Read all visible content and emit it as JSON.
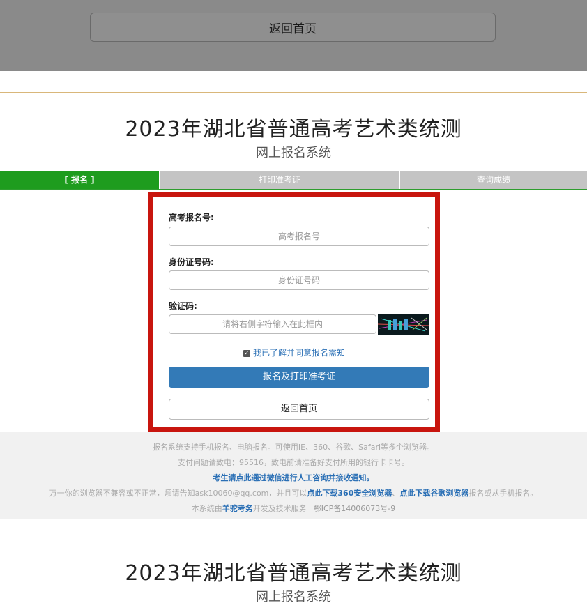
{
  "top_bar": {
    "back_label": "返回首页"
  },
  "header": {
    "title": "2023年湖北省普通高考艺术类统测",
    "subtitle": "网上报名系统"
  },
  "tabs": [
    {
      "label": "[ 报名 ]",
      "active": true
    },
    {
      "label": "打印准考证",
      "active": false
    },
    {
      "label": "查询成绩",
      "active": false
    }
  ],
  "form": {
    "exam_no_label": "高考报名号:",
    "exam_no_placeholder": "高考报名号",
    "id_label": "身份证号码:",
    "id_placeholder": "身份证号码",
    "captcha_label": "验证码:",
    "captcha_placeholder": "请将右侧字符输入在此框内",
    "agree_text": "我已了解并同意报名需知",
    "agree_checked": true,
    "submit_label": "报名及打印准考证",
    "back_label": "返回首页"
  },
  "footer": {
    "line1": "报名系统支持手机报名、电脑报名。可使用IE、360、谷歌、Safari等多个浏览器。",
    "line2": "支付问题请致电：95516，致电前请准备好支付所用的银行卡卡号。",
    "line3": "考生请点此通过微信进行人工咨询并接收通知。",
    "line4_prefix": "万一你的浏览器不兼容或不正常，烦请告知ask10060@qq.com，并且可以",
    "line4_link1": "点此下载360安全浏览器",
    "line4_sep": "、",
    "line4_link2": "点此下载谷歌浏览器",
    "line4_suffix": "报名或从手机报名。",
    "line5_prefix": "本系统由",
    "line5_link": "羊驼考务",
    "line5_suffix": "开发及技术服务",
    "icp": "鄂ICP备14006073号-9"
  },
  "colors": {
    "accent_green": "#1e9c1e",
    "highlight_red": "#c8150e",
    "primary_blue": "#337ab7"
  }
}
